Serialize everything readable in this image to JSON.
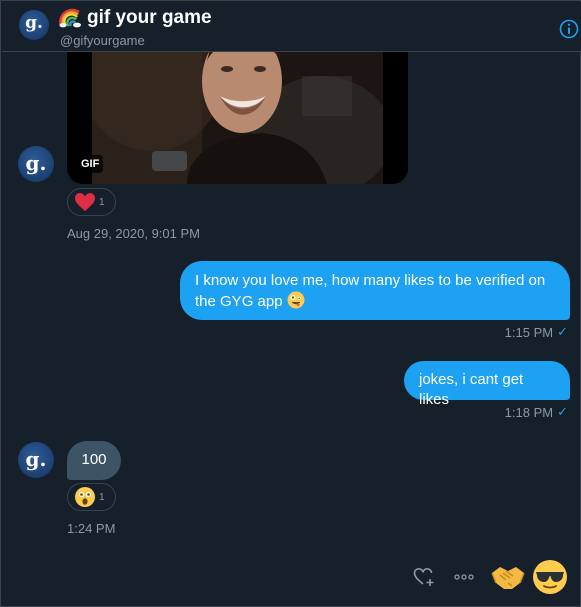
{
  "header": {
    "title": "gif your game",
    "handle": "@gifyourgame",
    "avatar_letter": "g."
  },
  "messages": {
    "gif": {
      "badge": "GIF",
      "reaction_count": "1",
      "timestamp": "Aug 29, 2020, 9:01 PM"
    },
    "out_1": {
      "text": "I know you love me, how many likes to be verified on the GYG app",
      "timestamp": "1:15 PM"
    },
    "out_2": {
      "text": "jokes, i cant get likes",
      "timestamp": "1:18 PM"
    },
    "in_1": {
      "text": "100",
      "reaction_count": "1",
      "timestamp": "1:24 PM"
    }
  },
  "colors": {
    "background": "#15202b",
    "accent": "#1da1f2",
    "incoming_bubble": "#3d5466",
    "muted_text": "#8899a6",
    "border": "#38444d"
  },
  "icons": {
    "header": [
      "rainbow-icon",
      "info-icon"
    ],
    "actions": [
      "add-reaction-heart-icon",
      "more-icon",
      "handshake-emoji-icon",
      "sunglasses-emoji-icon"
    ]
  }
}
